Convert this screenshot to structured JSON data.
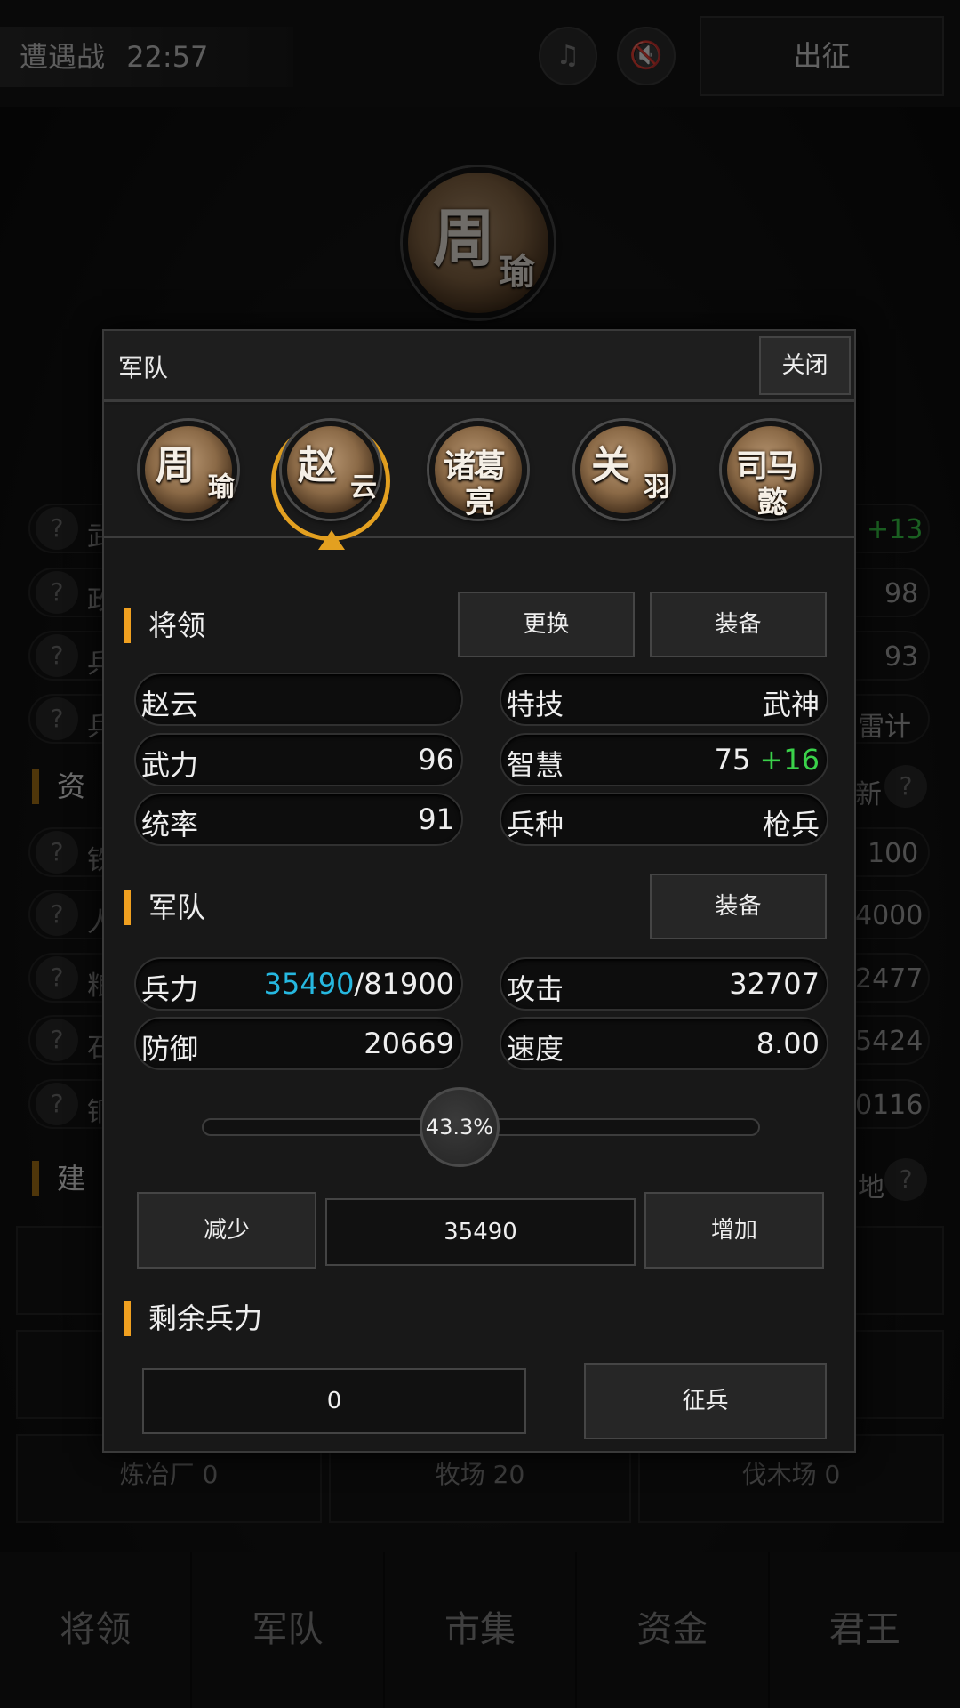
{
  "topbar": {
    "battle_label": "遭遇战",
    "battle_time": "22:57",
    "music_icon": "music-off-icon",
    "sound_icon": "sound-off-icon",
    "march_label": "出征"
  },
  "background": {
    "portrait_name_1": "周",
    "portrait_name_2": "瑜",
    "rows_left": [
      "武",
      "政",
      "兵",
      "兵"
    ],
    "rows_right": [
      "+13",
      "98",
      "93",
      "雷计"
    ],
    "section2_left": "资",
    "section2_right": "新",
    "res_left": [
      "铁",
      "人",
      "粮",
      "石",
      "铜"
    ],
    "res_right": [
      "100",
      "4000",
      "2477",
      "5424",
      "0116"
    ],
    "section3_left": "建",
    "section3_right": "地",
    "buildings": [
      {
        "name": "炼冶厂",
        "count": "0"
      },
      {
        "name": "牧场",
        "count": "20"
      },
      {
        "name": "伐木场",
        "count": "0"
      }
    ]
  },
  "nav": [
    "将领",
    "军队",
    "市集",
    "资金",
    "君王"
  ],
  "modal": {
    "title": "军队",
    "close_label": "关闭",
    "generals": [
      {
        "line1": "周",
        "line2": "瑜"
      },
      {
        "line1": "赵",
        "line2": "云"
      },
      {
        "line1": "诸葛",
        "line2": "亮"
      },
      {
        "line1": "关",
        "line2": "羽"
      },
      {
        "line1": "司马",
        "line2": "懿"
      }
    ],
    "selected_index": 1,
    "general_section": {
      "title": "将领",
      "replace_label": "更换",
      "equip_label": "装备"
    },
    "general_stats": {
      "name": "赵云",
      "skill_label": "特技",
      "skill_value": "武神",
      "force_label": "武力",
      "force_value": "96",
      "wisdom_label": "智慧",
      "wisdom_value": "75",
      "wisdom_bonus": "+16",
      "command_label": "统率",
      "command_value": "91",
      "troop_type_label": "兵种",
      "troop_type_value": "枪兵"
    },
    "army_section": {
      "title": "军队",
      "equip_label": "装备"
    },
    "army_stats": {
      "troops_label": "兵力",
      "troops_current": "35490",
      "troops_max": "/81900",
      "attack_label": "攻击",
      "attack_value": "32707",
      "defense_label": "防御",
      "defense_value": "20669",
      "speed_label": "速度",
      "speed_value": "8.00"
    },
    "slider": {
      "percent_label": "43.3%",
      "fraction": 0.433
    },
    "adjust": {
      "decrease_label": "减少",
      "amount": "35490",
      "increase_label": "增加"
    },
    "remaining": {
      "title": "剩余兵力",
      "value": "0",
      "recruit_label": "征兵"
    }
  },
  "colors": {
    "accent": "#f0a020",
    "selected_ring": "#e3a020",
    "troop_current": "#26b8e0",
    "bonus": "#3ad24a"
  }
}
